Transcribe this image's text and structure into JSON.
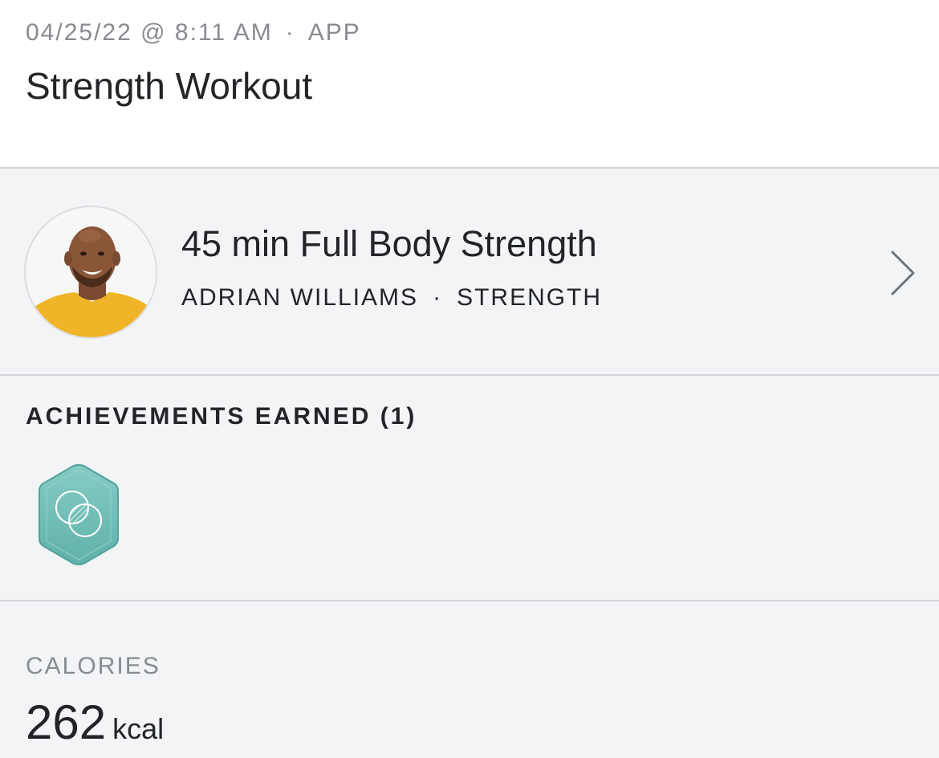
{
  "header": {
    "datetime": "04/25/22 @ 8:11 AM",
    "separator": "·",
    "source": "APP",
    "title": "Strength Workout"
  },
  "class_info": {
    "name": "45 min Full Body Strength",
    "instructor": "ADRIAN WILLIAMS",
    "separator": "·",
    "discipline": "STRENGTH",
    "avatar_icon": "instructor-avatar",
    "chevron_icon": "chevron-right-icon"
  },
  "achievements": {
    "title": "ACHIEVEMENTS EARNED (1)",
    "badges": [
      {
        "icon": "overlapping-circles-badge-icon",
        "color": "#6dbdb6"
      }
    ]
  },
  "calories": {
    "label": "CALORIES",
    "value": "262",
    "unit": "kcal"
  },
  "colors": {
    "background": "#f3f4f6",
    "header_background": "#ffffff",
    "text": "#222428",
    "muted_text": "#888b91",
    "divider": "#d4d5d8",
    "badge": "#6dbdb6",
    "shirt": "#f0b428"
  }
}
